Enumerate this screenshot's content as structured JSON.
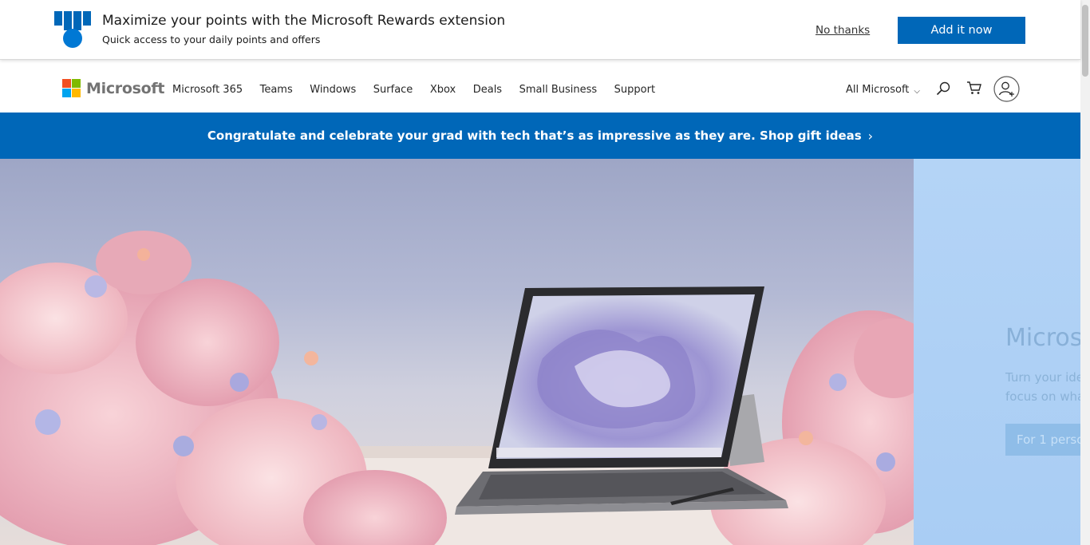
{
  "rewards_bar": {
    "title": "Maximize your points with the Microsoft Rewards extension",
    "subtitle": "Quick access to your daily points and offers",
    "no_thanks": "No thanks",
    "add_button": "Add it now"
  },
  "header": {
    "logo_text": "Microsoft",
    "logo_colors": [
      "#f25022",
      "#7fba00",
      "#00a4ef",
      "#ffb900"
    ],
    "nav": [
      "Microsoft 365",
      "Teams",
      "Windows",
      "Surface",
      "Xbox",
      "Deals",
      "Small Business",
      "Support"
    ],
    "all_microsoft": "All Microsoft",
    "icons": [
      "search-icon",
      "cart-icon",
      "account-icon"
    ]
  },
  "promo": {
    "text": "Congratulate and celebrate your grad with tech that’s as impressive as they are. Shop gift ideas",
    "chevron": "›"
  },
  "hero": {
    "image": "Surface laptop with keyboard and pen surrounded by pink flowers"
  },
  "side_slide": {
    "title": "Microso",
    "line1": "Turn your ide",
    "line2": "focus on wha",
    "button": "For 1 perso"
  },
  "colors": {
    "accent": "#0067b8",
    "text": "#262626"
  }
}
